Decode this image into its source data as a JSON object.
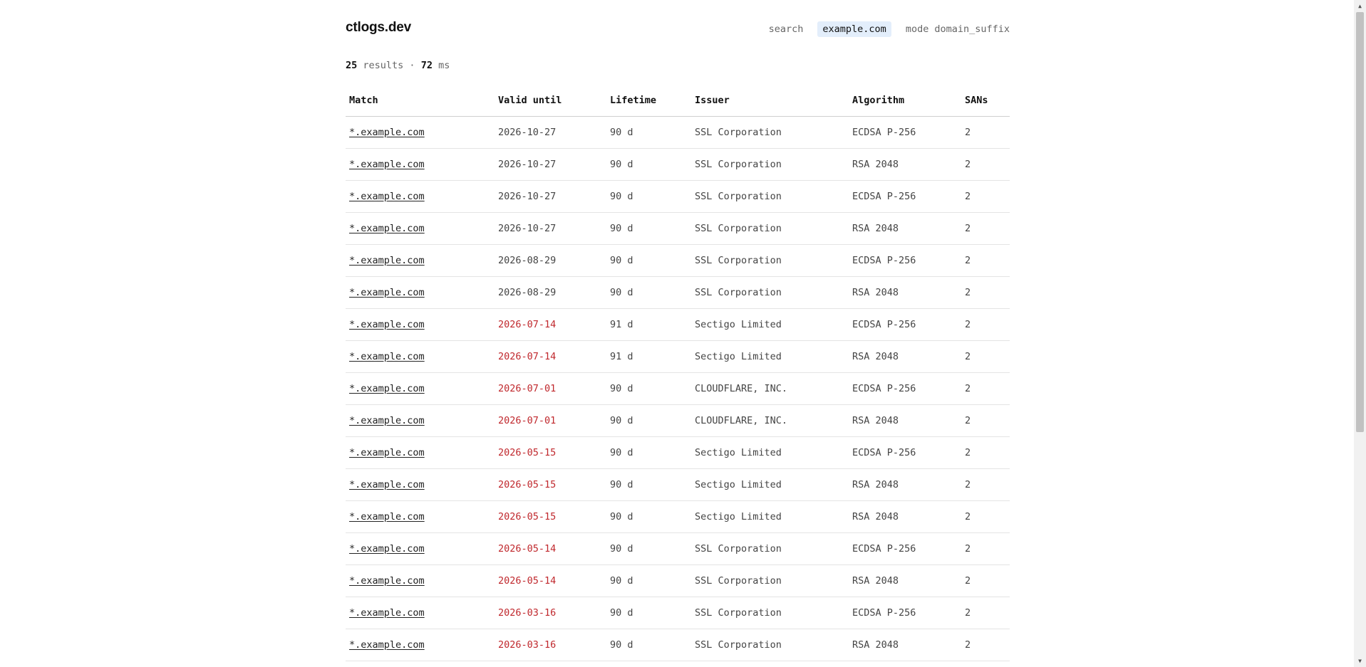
{
  "header": {
    "brand": "ctlogs.dev",
    "search_label": "search",
    "query": "example.com",
    "mode_label": "mode",
    "mode_value": "domain_suffix"
  },
  "summary": {
    "count": "25",
    "count_label": "results ·",
    "time": "72",
    "time_unit": "ms"
  },
  "table": {
    "columns": [
      "Match",
      "Valid until",
      "Lifetime",
      "Issuer",
      "Algorithm",
      "SANs"
    ],
    "rows": [
      {
        "match": "*.example.com",
        "valid_until": "2026-10-27",
        "lifetime": "90 d",
        "issuer": "SSL Corporation",
        "algorithm": "ECDSA P-256",
        "sans": "2",
        "expiring": false
      },
      {
        "match": "*.example.com",
        "valid_until": "2026-10-27",
        "lifetime": "90 d",
        "issuer": "SSL Corporation",
        "algorithm": "RSA 2048",
        "sans": "2",
        "expiring": false
      },
      {
        "match": "*.example.com",
        "valid_until": "2026-10-27",
        "lifetime": "90 d",
        "issuer": "SSL Corporation",
        "algorithm": "ECDSA P-256",
        "sans": "2",
        "expiring": false
      },
      {
        "match": "*.example.com",
        "valid_until": "2026-10-27",
        "lifetime": "90 d",
        "issuer": "SSL Corporation",
        "algorithm": "RSA 2048",
        "sans": "2",
        "expiring": false
      },
      {
        "match": "*.example.com",
        "valid_until": "2026-08-29",
        "lifetime": "90 d",
        "issuer": "SSL Corporation",
        "algorithm": "ECDSA P-256",
        "sans": "2",
        "expiring": false
      },
      {
        "match": "*.example.com",
        "valid_until": "2026-08-29",
        "lifetime": "90 d",
        "issuer": "SSL Corporation",
        "algorithm": "RSA 2048",
        "sans": "2",
        "expiring": false
      },
      {
        "match": "*.example.com",
        "valid_until": "2026-07-14",
        "lifetime": "91 d",
        "issuer": "Sectigo Limited",
        "algorithm": "ECDSA P-256",
        "sans": "2",
        "expiring": true
      },
      {
        "match": "*.example.com",
        "valid_until": "2026-07-14",
        "lifetime": "91 d",
        "issuer": "Sectigo Limited",
        "algorithm": "RSA 2048",
        "sans": "2",
        "expiring": true
      },
      {
        "match": "*.example.com",
        "valid_until": "2026-07-01",
        "lifetime": "90 d",
        "issuer": "CLOUDFLARE, INC.",
        "algorithm": "ECDSA P-256",
        "sans": "2",
        "expiring": true
      },
      {
        "match": "*.example.com",
        "valid_until": "2026-07-01",
        "lifetime": "90 d",
        "issuer": "CLOUDFLARE, INC.",
        "algorithm": "RSA 2048",
        "sans": "2",
        "expiring": true
      },
      {
        "match": "*.example.com",
        "valid_until": "2026-05-15",
        "lifetime": "90 d",
        "issuer": "Sectigo Limited",
        "algorithm": "ECDSA P-256",
        "sans": "2",
        "expiring": true
      },
      {
        "match": "*.example.com",
        "valid_until": "2026-05-15",
        "lifetime": "90 d",
        "issuer": "Sectigo Limited",
        "algorithm": "RSA 2048",
        "sans": "2",
        "expiring": true
      },
      {
        "match": "*.example.com",
        "valid_until": "2026-05-15",
        "lifetime": "90 d",
        "issuer": "Sectigo Limited",
        "algorithm": "RSA 2048",
        "sans": "2",
        "expiring": true
      },
      {
        "match": "*.example.com",
        "valid_until": "2026-05-14",
        "lifetime": "90 d",
        "issuer": "SSL Corporation",
        "algorithm": "ECDSA P-256",
        "sans": "2",
        "expiring": true
      },
      {
        "match": "*.example.com",
        "valid_until": "2026-05-14",
        "lifetime": "90 d",
        "issuer": "SSL Corporation",
        "algorithm": "RSA 2048",
        "sans": "2",
        "expiring": true
      },
      {
        "match": "*.example.com",
        "valid_until": "2026-03-16",
        "lifetime": "90 d",
        "issuer": "SSL Corporation",
        "algorithm": "ECDSA P-256",
        "sans": "2",
        "expiring": true
      },
      {
        "match": "*.example.com",
        "valid_until": "2026-03-16",
        "lifetime": "90 d",
        "issuer": "SSL Corporation",
        "algorithm": "RSA 2048",
        "sans": "2",
        "expiring": true
      }
    ]
  },
  "colors": {
    "expiring_date": "#c0282d",
    "query_chip_bg": "#e3eefb"
  },
  "scrollbar": {
    "up_icon": "triangle-up-icon",
    "down_icon": "triangle-down-icon"
  }
}
